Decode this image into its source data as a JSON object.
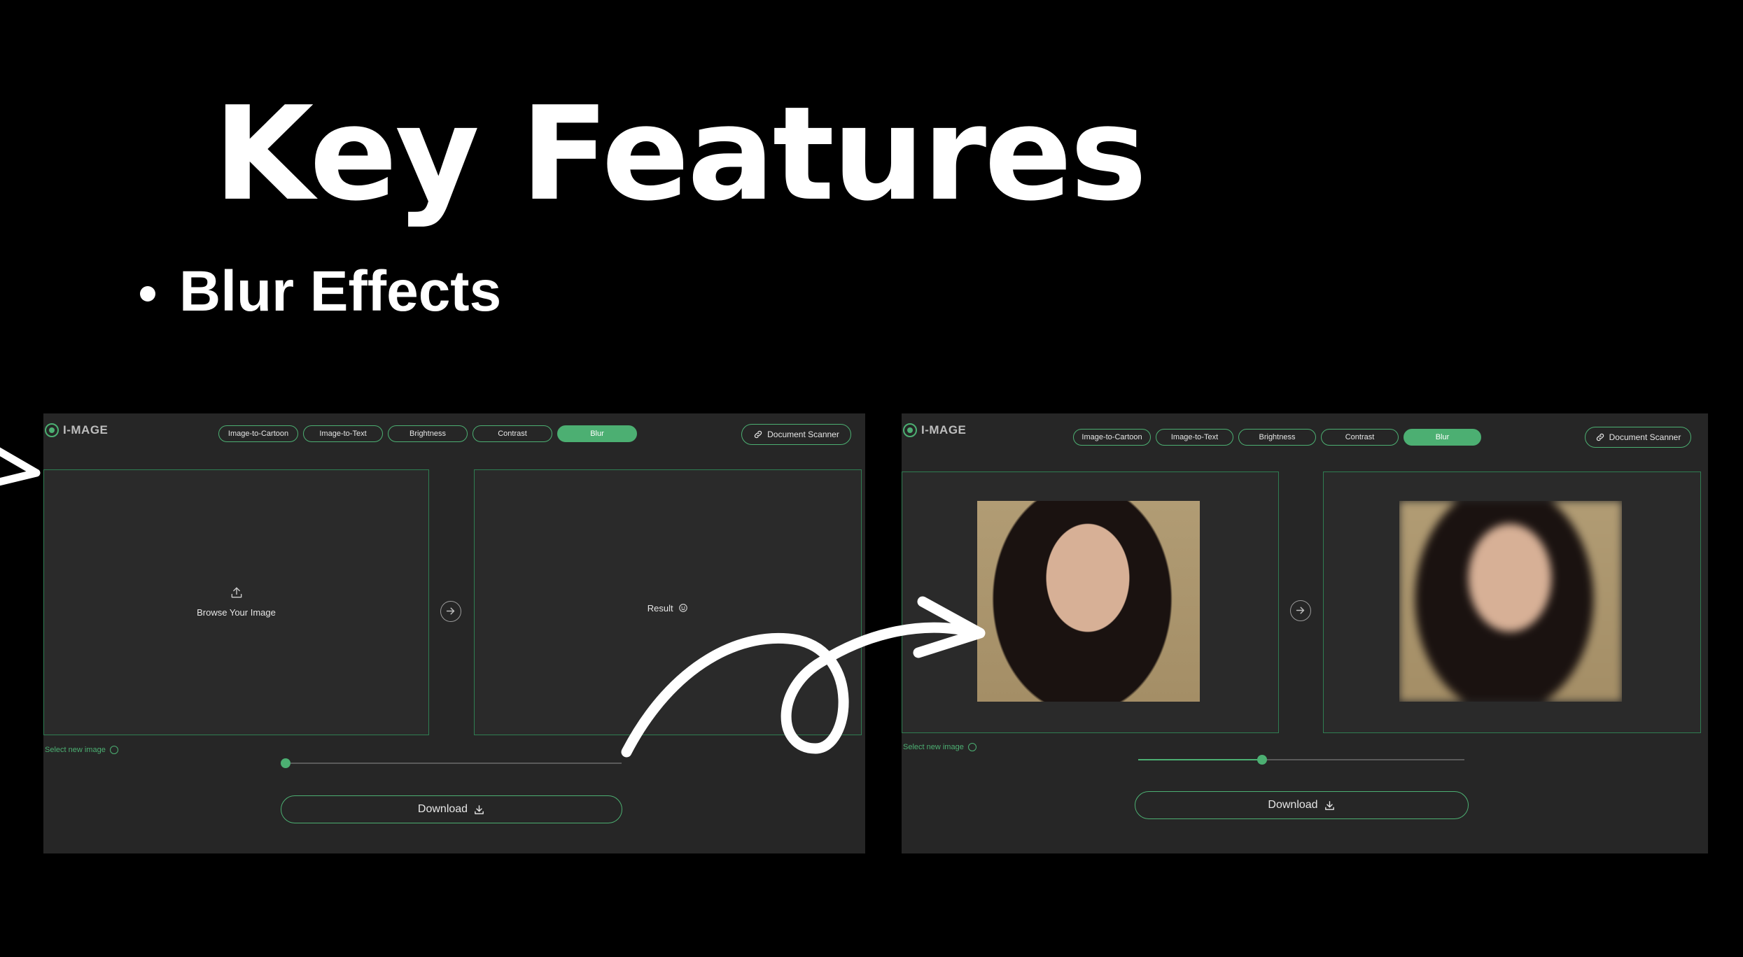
{
  "slide": {
    "title": "Key Features",
    "bullet": "Blur Effects"
  },
  "app": {
    "logo_text": "I-MAGE",
    "tabs": [
      {
        "label": "Image-to-Cartoon",
        "active": false
      },
      {
        "label": "Image-to-Text",
        "active": false
      },
      {
        "label": "Brightness",
        "active": false
      },
      {
        "label": "Contrast",
        "active": false
      },
      {
        "label": "Blur",
        "active": true
      }
    ],
    "doc_scanner_label": "Document Scanner",
    "browse_label": "Browse Your Image",
    "result_label": "Result",
    "select_new_label": "Select new image",
    "download_label": "Download"
  },
  "slider_values": {
    "left": 0,
    "right": 0.38
  },
  "colors": {
    "accent": "#4caf72",
    "panel_bg": "#262626",
    "page_bg": "#000000"
  }
}
